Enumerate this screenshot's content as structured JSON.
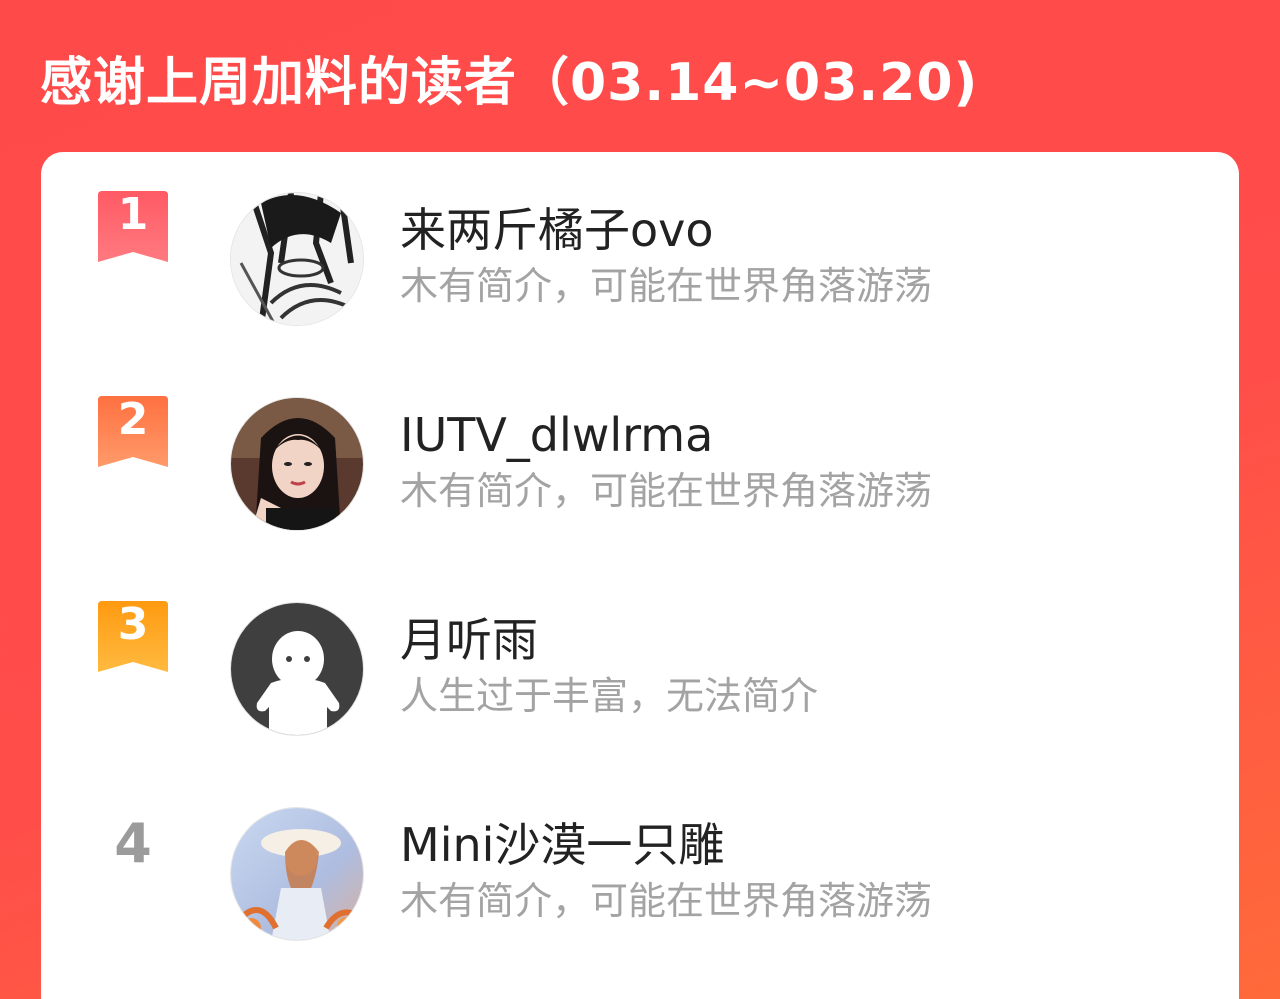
{
  "header": {
    "title": "感谢上周加料的读者（03.14~03.20)"
  },
  "colors": {
    "background": "#ff4a4a",
    "rank1": "#ff5a5f",
    "rank2": "#ff7a45",
    "rank3": "#ffa31a",
    "rank_plain": "#9b9b9b"
  },
  "readers": [
    {
      "rank": "1",
      "name": "来两斤橘子ovo",
      "bio": "木有简介，可能在世界角落游荡",
      "avatar_icon": "manga-avatar-icon"
    },
    {
      "rank": "2",
      "name": "IUTV_dlwlrma",
      "bio": "木有简介，可能在世界角落游荡",
      "avatar_icon": "photo-avatar-icon"
    },
    {
      "rank": "3",
      "name": "月听雨",
      "bio": "人生过于丰富，无法简介",
      "avatar_icon": "default-avatar-icon"
    },
    {
      "rank": "4",
      "name": "Mini沙漠一只雕",
      "bio": "木有简介，可能在世界角落游荡",
      "avatar_icon": "illustration-avatar-icon"
    }
  ]
}
